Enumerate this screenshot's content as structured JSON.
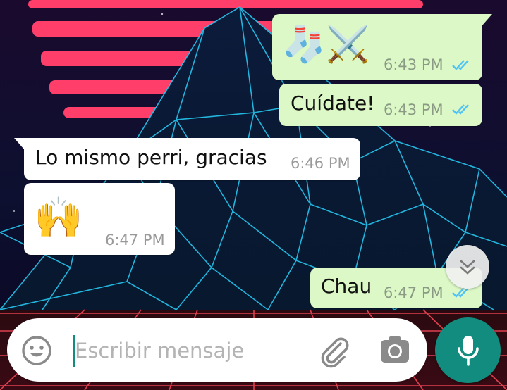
{
  "messages": [
    {
      "direction": "out",
      "content": "🧦⚔️",
      "time": "6:43 PM",
      "status": "read"
    },
    {
      "direction": "out",
      "content": "Cuídate!",
      "time": "6:43 PM",
      "status": "read"
    },
    {
      "direction": "in",
      "content": "Lo mismo perri, gracias",
      "time": "6:46 PM"
    },
    {
      "direction": "in",
      "content": "🙌",
      "time": "6:47 PM"
    },
    {
      "direction": "out",
      "content": "Chau",
      "time": "6:47 PM",
      "status": "read"
    }
  ],
  "composer": {
    "placeholder": "Escribir mensaje",
    "emoji_icon": "emoji-icon",
    "attach_icon": "paperclip-icon",
    "camera_icon": "camera-icon",
    "mic_icon": "microphone-icon"
  },
  "scroll_button_icon": "double-chevron-down-icon",
  "colors": {
    "outgoing_bubble": "#dcf8c6",
    "incoming_bubble": "#ffffff",
    "read_ticks": "#4fc3f7",
    "accent": "#128c7e"
  }
}
